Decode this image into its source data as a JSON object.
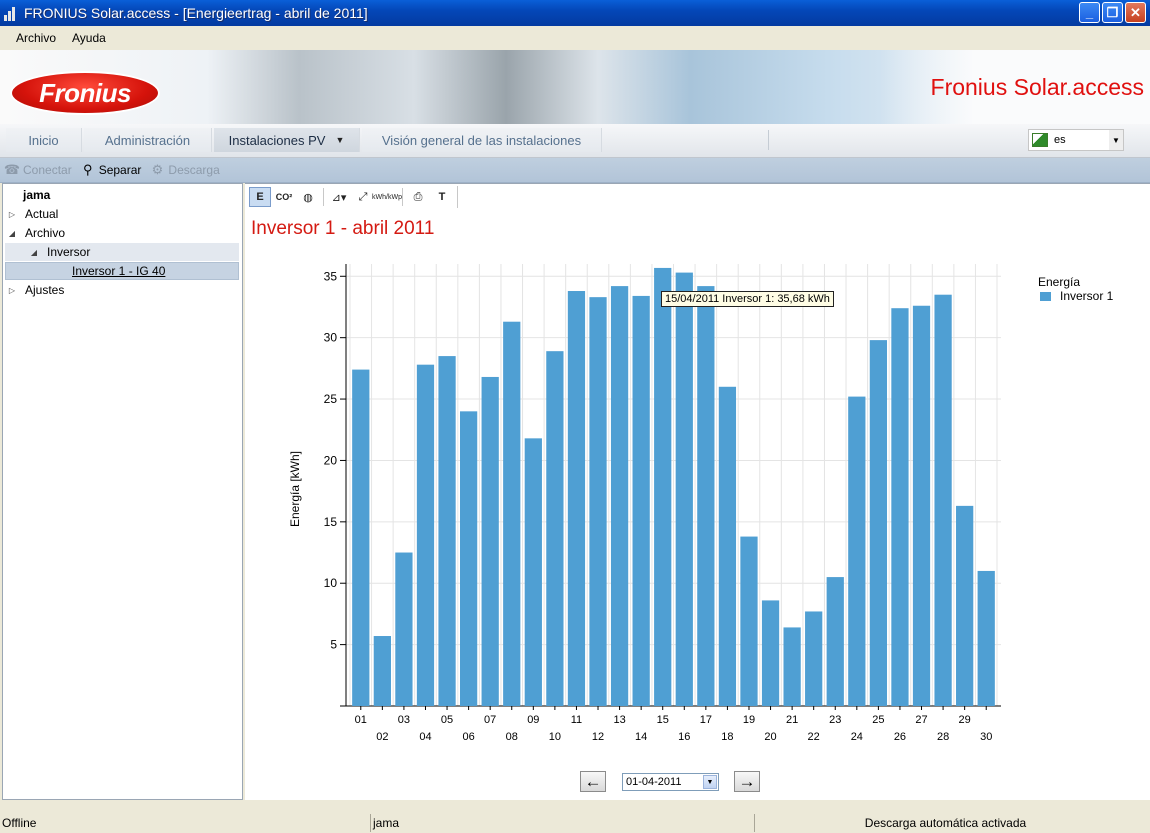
{
  "window": {
    "title": "FRONIUS Solar.access - [Energieertrag - abril de 2011]"
  },
  "menu": {
    "items": [
      "Archivo",
      "Ayuda"
    ]
  },
  "banner": {
    "logo_text": "Fronius",
    "brand_title": "Fronius Solar.access"
  },
  "nav": {
    "tabs": [
      "Inicio",
      "Administración",
      "Instalaciones PV",
      "Visión general de las instalaciones"
    ],
    "active_tab": "Instalaciones PV",
    "language": "es"
  },
  "toolbar": {
    "connect": "Conectar",
    "disconnect": "Separar",
    "download": "Descarga"
  },
  "tree": {
    "root": "jama",
    "actual": "Actual",
    "archivo": "Archivo",
    "inversor": "Inversor",
    "inversor_device": "Inversor 1 - IG 40",
    "ajustes": "Ajustes"
  },
  "chart_tools": {
    "energy": "E",
    "co2": "CO²",
    "kwh_kwp": "kWh/kWp",
    "text": "T"
  },
  "chart_title": "Inversor 1 - abril 2011",
  "tooltip": "15/04/2011 Inversor 1: 35,68 kWh",
  "chart_data": {
    "type": "bar",
    "title": "Inversor 1 - abril 2011",
    "xlabel": "",
    "ylabel": "Energía [kWh]",
    "ylim": [
      0,
      36
    ],
    "yticks": [
      5,
      10,
      15,
      20,
      25,
      30,
      35
    ],
    "grid": true,
    "legend_title": "Energía",
    "legend_position": "top-right",
    "color": "#4f9fd3",
    "categories": [
      "01",
      "02",
      "03",
      "04",
      "05",
      "06",
      "07",
      "08",
      "09",
      "10",
      "11",
      "12",
      "13",
      "14",
      "15",
      "16",
      "17",
      "18",
      "19",
      "20",
      "21",
      "22",
      "23",
      "24",
      "25",
      "26",
      "27",
      "28",
      "29",
      "30"
    ],
    "series": [
      {
        "name": "Inversor 1",
        "values": [
          27.4,
          5.7,
          12.5,
          27.8,
          28.5,
          24.0,
          26.8,
          31.3,
          21.8,
          28.9,
          33.8,
          33.3,
          34.2,
          33.4,
          35.68,
          35.3,
          34.2,
          26.0,
          13.8,
          8.6,
          6.4,
          7.7,
          10.5,
          25.2,
          29.8,
          32.4,
          32.6,
          33.5,
          16.3,
          11.0
        ]
      }
    ]
  },
  "pager": {
    "date": "01-04-2011"
  },
  "status": {
    "connection": "Offline",
    "user": "jama",
    "download_status": "Descarga automática activada"
  }
}
